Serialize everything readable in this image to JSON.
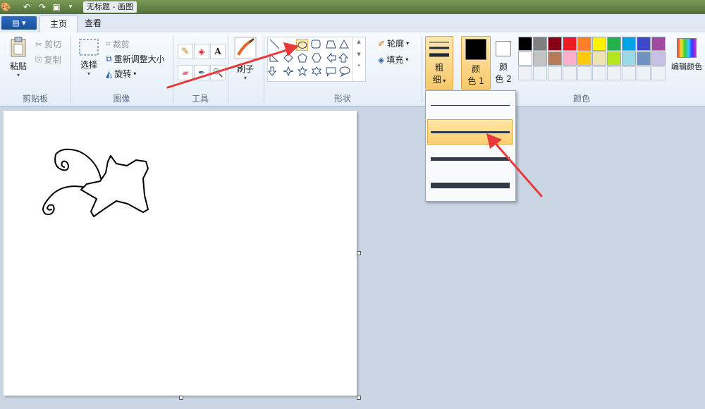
{
  "window": {
    "title": "无标题 - 画图"
  },
  "tabs": {
    "menu_icon": "menu-icon",
    "home": "主页",
    "view": "查看"
  },
  "clipboard": {
    "paste": "粘贴",
    "cut": "剪切",
    "copy": "复制",
    "label": "剪贴板"
  },
  "image": {
    "select": "选择",
    "crop": "裁剪",
    "resize": "重新调整大小",
    "rotate": "旋转",
    "label": "图像"
  },
  "tools": {
    "label": "工具"
  },
  "brushes": {
    "label": "刷子"
  },
  "shapes": {
    "outline": "轮廓",
    "fill": "填充",
    "label": "形状"
  },
  "size": {
    "line1": "粗",
    "line2": "细"
  },
  "colors": {
    "color1_line1": "颜",
    "color1_line2": "色 1",
    "color2_line1": "颜",
    "color2_line2": "色 2",
    "edit": "编辑颜色",
    "label": "颜色",
    "palette_row1": [
      "#000000",
      "#7f7f7f",
      "#880015",
      "#ed1c24",
      "#ff7f27",
      "#fff200",
      "#22b14c",
      "#00a2e8",
      "#3f48cc",
      "#a349a4"
    ],
    "palette_row2": [
      "#ffffff",
      "#c3c3c3",
      "#b97a57",
      "#ffaec9",
      "#ffc90e",
      "#efe4b0",
      "#b5e61d",
      "#99d9ea",
      "#7092be",
      "#c8bfe7"
    ],
    "color1": "#000000",
    "color2": "#ffffff"
  },
  "size_options": [
    {
      "weight": 1,
      "highlighted": false
    },
    {
      "weight": 3,
      "highlighted": true
    },
    {
      "weight": 5,
      "highlighted": false
    },
    {
      "weight": 8,
      "highlighted": false
    }
  ],
  "annotation_color": "#e83a3a"
}
